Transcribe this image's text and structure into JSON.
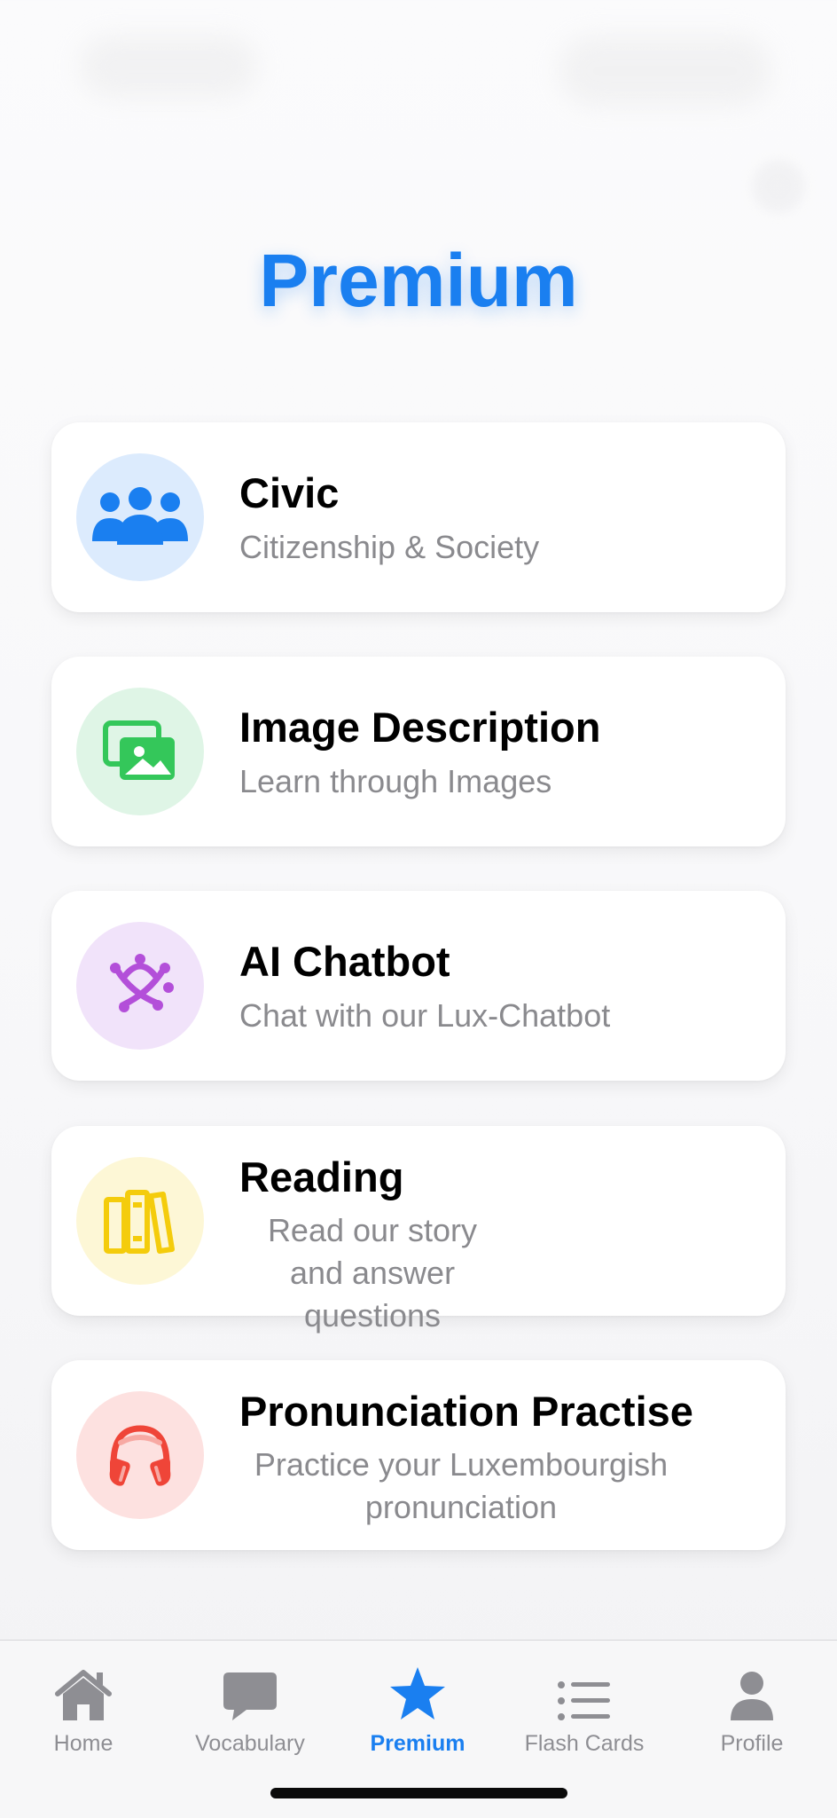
{
  "header": {
    "title": "Premium"
  },
  "cards": [
    {
      "title": "Civic",
      "subtitle": "Citizenship & Society",
      "icon": "people-group-icon",
      "circle_color": "#dcebfd",
      "icon_color": "#1a7ff0"
    },
    {
      "title": "Image Description",
      "subtitle": "Learn through Images",
      "icon": "photos-icon",
      "circle_color": "#dff5e6",
      "icon_color": "#34c75a"
    },
    {
      "title": "AI Chatbot",
      "subtitle": "Chat with our Lux-Chatbot",
      "icon": "ai-chatbot-icon",
      "circle_color": "#f1e3fa",
      "icon_color": "#b34fd9"
    },
    {
      "title": "Reading",
      "subtitle": "Read our story and answer questions",
      "icon": "books-icon",
      "circle_color": "#fdf7d6",
      "icon_color": "#f4cc0c"
    },
    {
      "title": "Pronunciation Practise",
      "subtitle": "Practice your Luxembourgish pronunciation",
      "icon": "headphones-icon",
      "circle_color": "#fde1e0",
      "icon_color": "#ef4538"
    }
  ],
  "tabbar": {
    "tabs": [
      {
        "label": "Home",
        "icon": "house-icon"
      },
      {
        "label": "Vocabulary",
        "icon": "speech-bubble-icon"
      },
      {
        "label": "Premium",
        "icon": "star-icon",
        "active": true
      },
      {
        "label": "Flash Cards",
        "icon": "list-icon"
      },
      {
        "label": "Profile",
        "icon": "person-icon"
      }
    ],
    "active_color": "#1a7ff0",
    "inactive_color": "#8e8e93"
  }
}
